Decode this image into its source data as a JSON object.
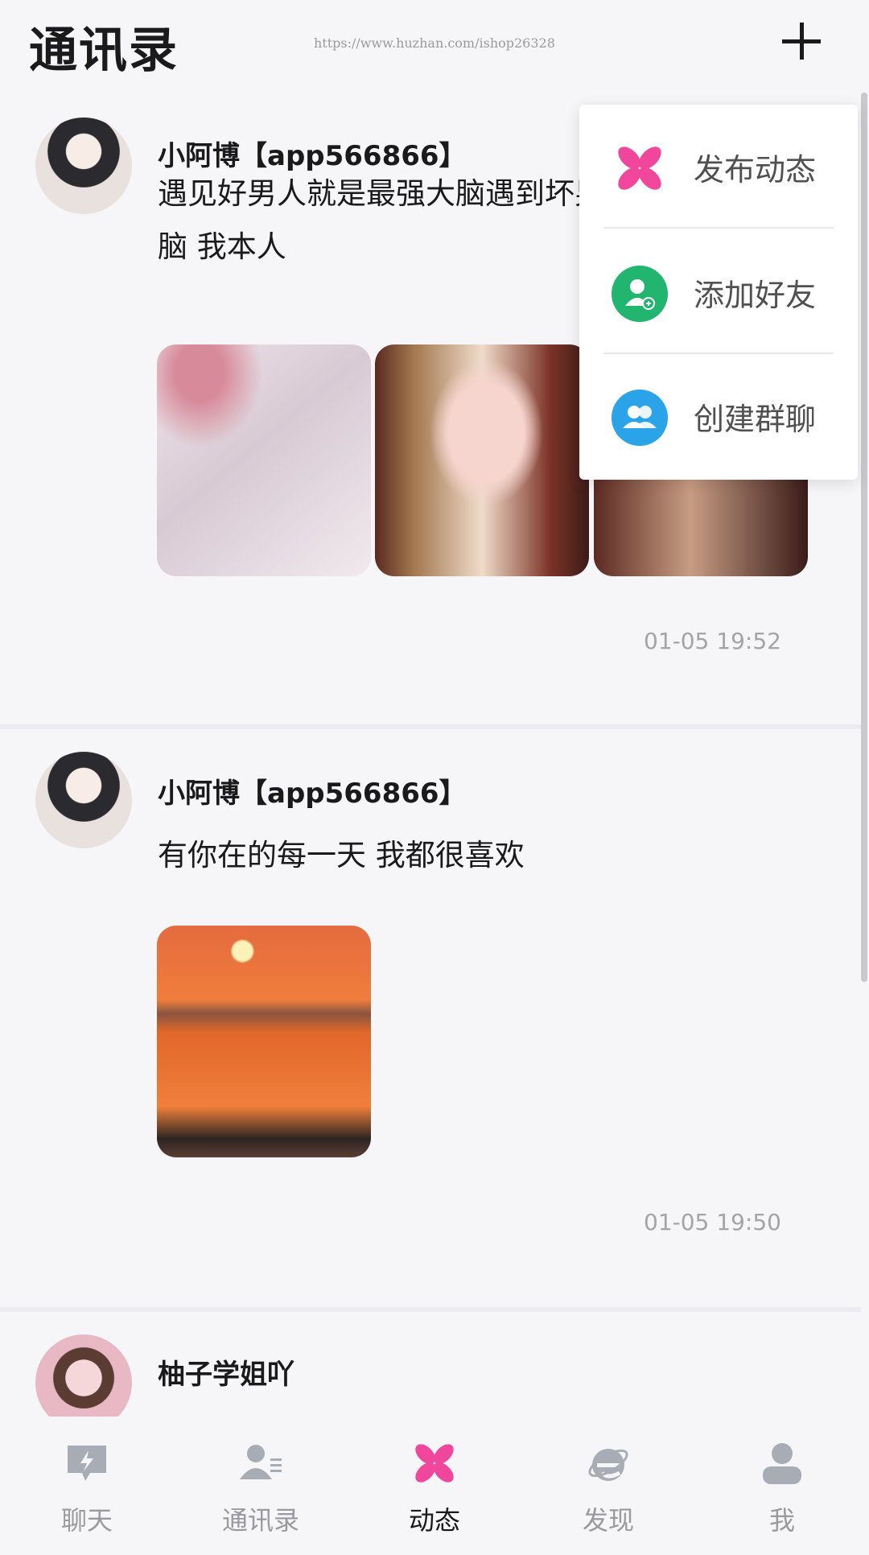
{
  "header": {
    "title": "通讯录",
    "watermark": "https://www.huzhan.com/ishop26328",
    "add_icon": "plus-icon"
  },
  "menu": {
    "items": [
      {
        "label": "发布动态",
        "icon": "pinwheel-icon"
      },
      {
        "label": "添加好友",
        "icon": "add-friend-icon"
      },
      {
        "label": "创建群聊",
        "icon": "group-chat-icon"
      }
    ]
  },
  "posts": [
    {
      "author": "小阿博【app566866】",
      "text": "遇见好男人就是最强大脑遇到坏男人就是恋爱脑 我本人",
      "timestamp": "01-05 19:52"
    },
    {
      "author": "小阿博【app566866】",
      "text": "有你在的每一天 我都很喜欢",
      "timestamp": "01-05 19:50"
    },
    {
      "author": "柚子学姐吖"
    }
  ],
  "tabs": [
    {
      "label": "聊天",
      "icon": "chat-icon"
    },
    {
      "label": "通讯录",
      "icon": "contacts-icon"
    },
    {
      "label": "动态",
      "icon": "pinwheel-icon",
      "active": true
    },
    {
      "label": "发现",
      "icon": "discover-icon"
    },
    {
      "label": "我",
      "icon": "profile-icon"
    }
  ],
  "colors": {
    "accent_pink": "#f0479c",
    "green": "#21b56f",
    "blue": "#2aa3e8"
  }
}
